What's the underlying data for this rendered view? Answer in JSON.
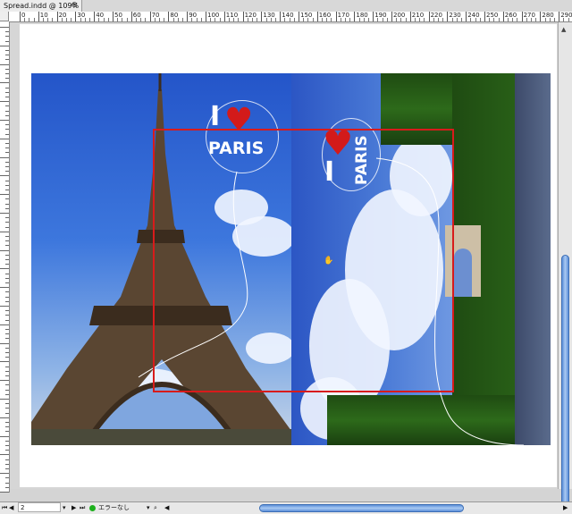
{
  "tab": {
    "title": "Spread.indd @ 109%",
    "close": "⊗"
  },
  "ruler": {
    "h_labels": [
      "0",
      "10",
      "20",
      "30",
      "40",
      "50",
      "60",
      "70",
      "80",
      "90",
      "100",
      "110",
      "120",
      "130",
      "140",
      "150",
      "160",
      "170",
      "180",
      "190",
      "200",
      "210",
      "220",
      "230",
      "240",
      "250",
      "260",
      "270",
      "280",
      "290",
      "300"
    ]
  },
  "artwork": {
    "left_logo": {
      "i": "I",
      "word": "PARIS"
    },
    "right_logo": {
      "i": "I",
      "word": "PARIS"
    }
  },
  "status": {
    "page_number": "2",
    "preflight": "エラーなし"
  },
  "colors": {
    "frame": "#d81b1b",
    "accent": "#5c90d9"
  }
}
